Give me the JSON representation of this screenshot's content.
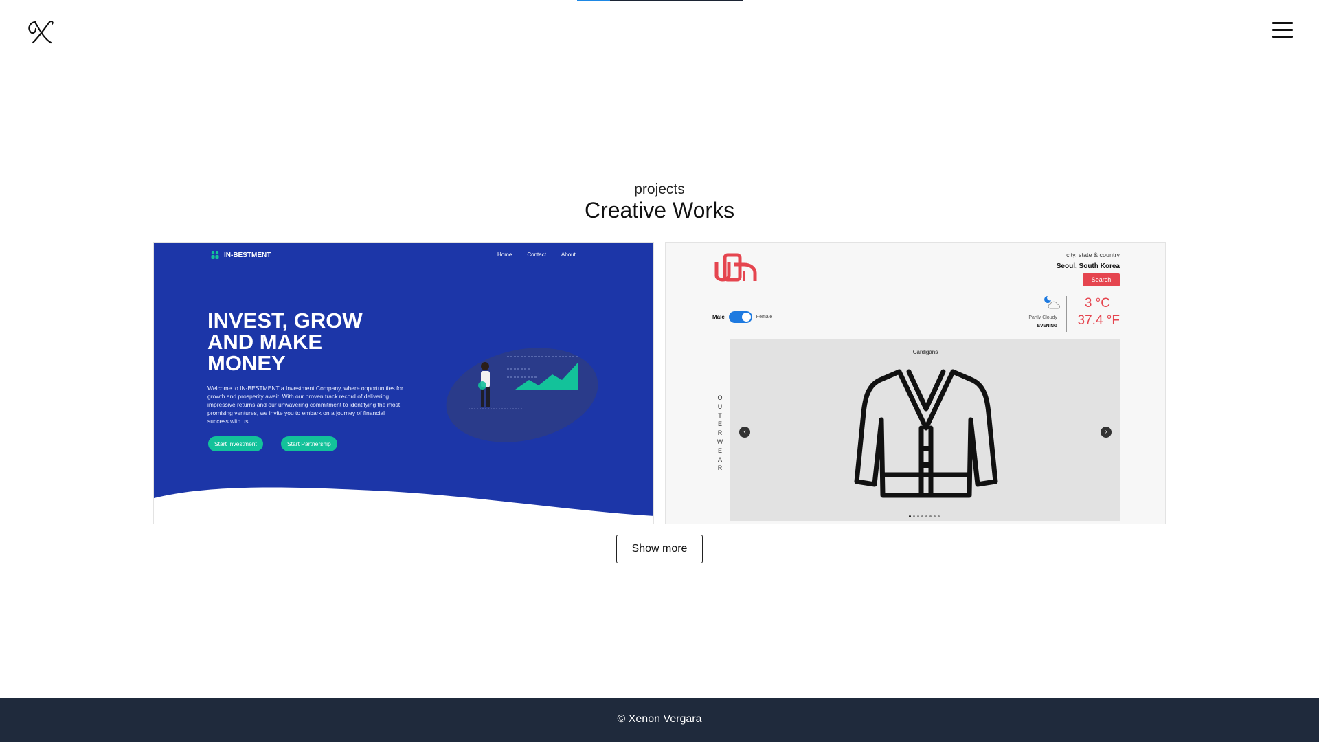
{
  "header": {
    "logo_icon": "script-x-logo-icon",
    "menu_icon": "hamburger-menu-icon"
  },
  "section": {
    "subtitle": "projects",
    "title": "Creative Works"
  },
  "projects": [
    {
      "name": "IN-BESTMENT",
      "nav": [
        "Home",
        "Contact",
        "About"
      ],
      "hero": "INVEST, GROW AND MAKE MONEY",
      "description": "Welcome to IN-BESTMENT a Investment Company, where opportunities for growth and prosperity await. With our proven track record of delivering impressive returns and our unwavering commitment to identifying the most promising ventures, we invite you to embark on a journey of financial success with us.",
      "buttons": [
        "Start Investment",
        "Start Partnership"
      ],
      "colors": {
        "background": "#1c36a8",
        "accent": "#13c29a"
      }
    },
    {
      "location_label": "city, state & country",
      "location": "Seoul, South Korea",
      "search_label": "Search",
      "gender": {
        "male": "Male",
        "female": "Female",
        "selected": "Male"
      },
      "condition": "Partly Cloudy",
      "time_of_day": "EVENING",
      "temp_c": "3 °C",
      "temp_f": "37.4 °F",
      "category": "Cardigans",
      "vertical_label": "OUTERWEAR",
      "prev_label": "‹",
      "next_label": "›",
      "carousel_dots": 8,
      "active_dot": 1,
      "colors": {
        "accent": "#e5454f",
        "toggle": "#1e7ae0"
      }
    }
  ],
  "actions": {
    "show_more": "Show more"
  },
  "footer": {
    "copyright": "© Xenon Vergara"
  },
  "colors": {
    "footer_bg": "#1f2a3c",
    "scroll_progress": "#1e88e5"
  }
}
